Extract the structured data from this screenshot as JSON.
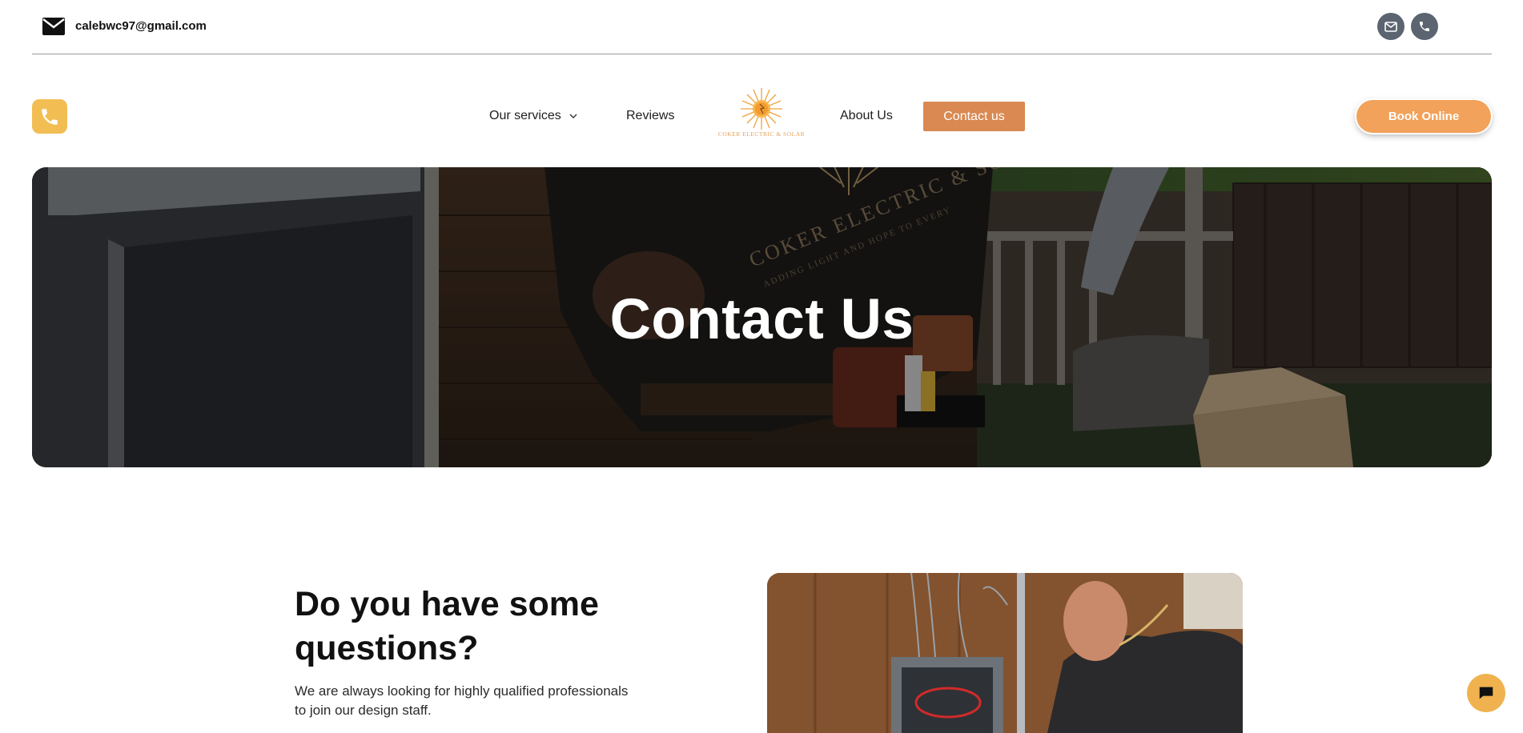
{
  "topbar": {
    "email": "calebwc97@gmail.com"
  },
  "nav": {
    "services": "Our services",
    "reviews": "Reviews",
    "about": "About Us",
    "contact": "Contact us",
    "book": "Book Online"
  },
  "logo": {
    "caption": "COKER ELECTRIC & SOLAR"
  },
  "hero": {
    "title": "Contact Us",
    "shirt_line1": "COKER ELECTRIC & SOLAR",
    "shirt_line2": "ADDING LIGHT AND HOPE TO EVERY"
  },
  "section": {
    "title": "Do you have some questions?",
    "text": "We are always looking for highly qualified professionals to join our design staff."
  },
  "colors": {
    "accent_orange": "#d98951",
    "book_orange": "#f2a25a",
    "tile_yellow": "#f2be54",
    "icon_gray": "#5b6470"
  }
}
